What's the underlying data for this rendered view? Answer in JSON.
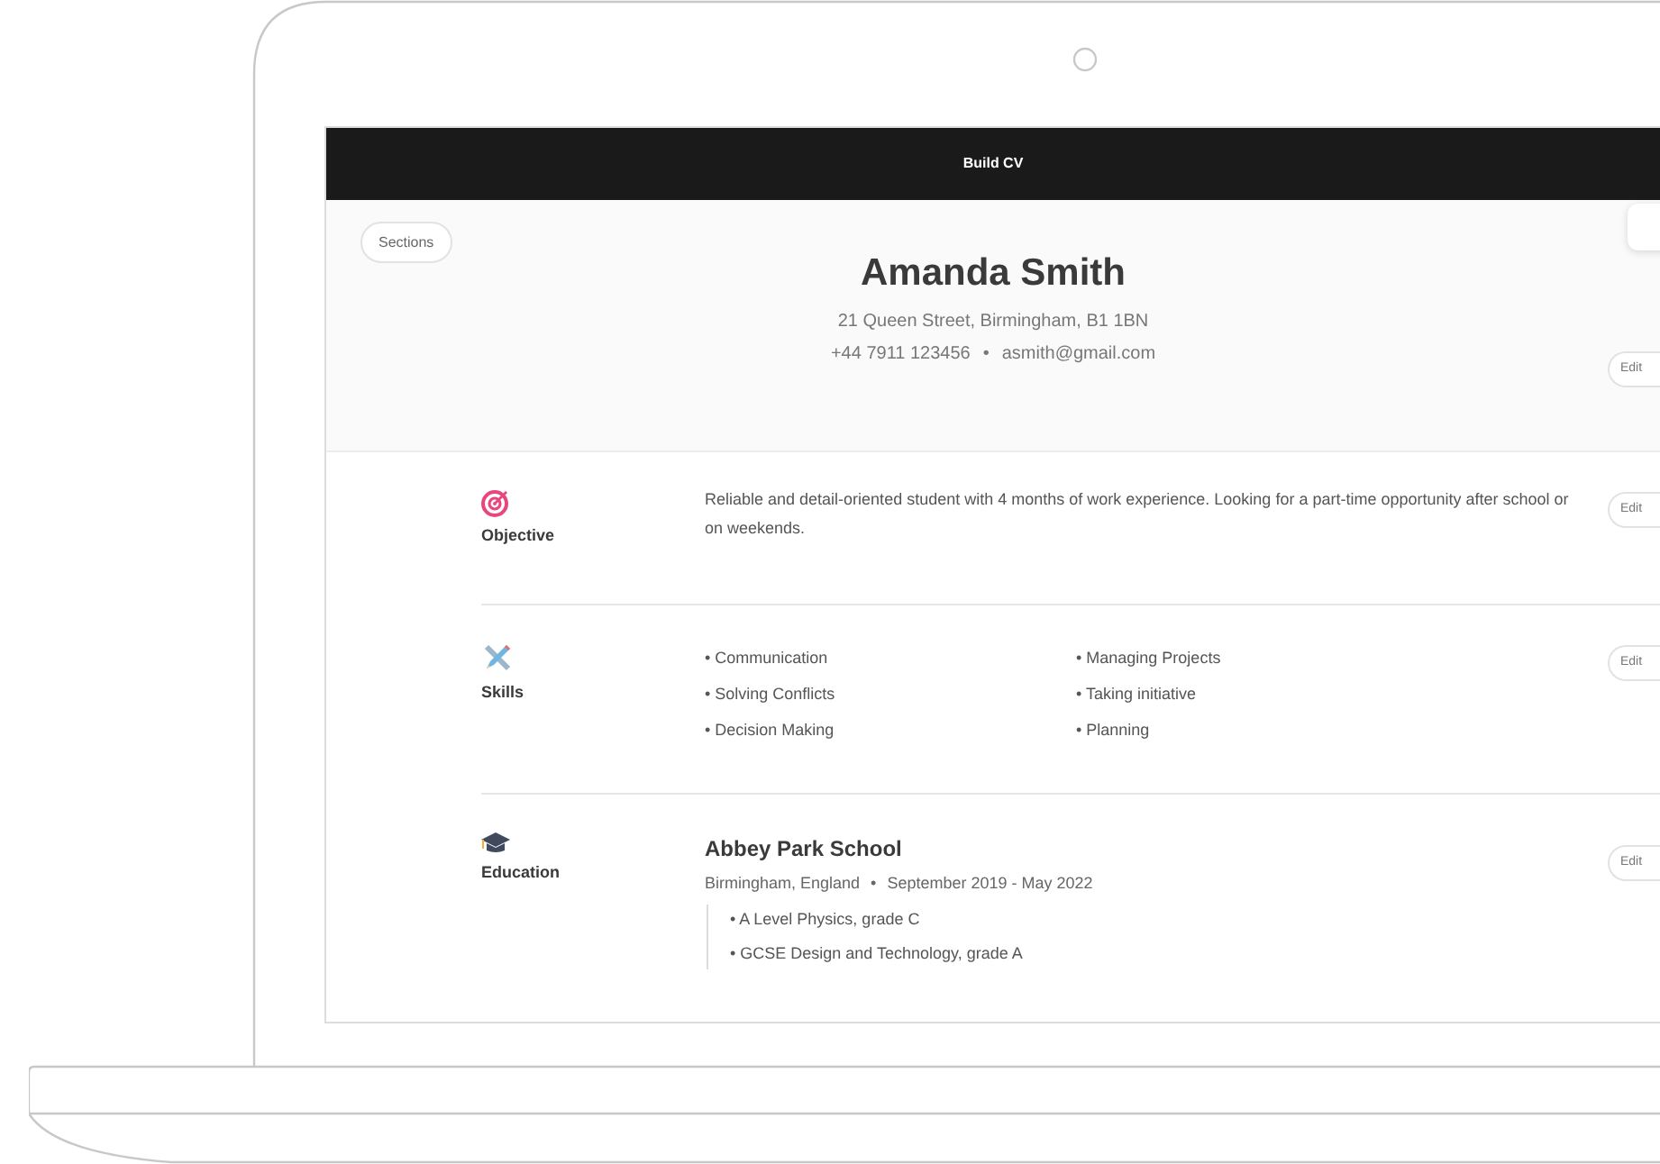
{
  "window": {
    "title": "Build CV"
  },
  "sections_button": "Sections",
  "header": {
    "name": "Amanda Smith",
    "address": "21 Queen Street, Birmingham, B1 1BN",
    "phone": "+44 7911 123456",
    "separator": "•",
    "email": "asmith@gmail.com",
    "edit": "Edit"
  },
  "sections": [
    {
      "kind": "objective",
      "label": "Objective",
      "edit": "Edit",
      "text": "Reliable and detail-oriented student with 4 months of work experience. Looking for a part-time opportunity after school or on weekends."
    },
    {
      "kind": "skills",
      "label": "Skills",
      "edit": "Edit",
      "columns": [
        [
          "• Communication",
          "• Solving Conflicts",
          "• Decision Making"
        ],
        [
          "• Managing Projects",
          "• Taking initiative",
          "• Planning"
        ]
      ]
    },
    {
      "kind": "education",
      "label": "Education",
      "edit": "Edit",
      "school": "Abbey Park School",
      "location": "Birmingham, England",
      "separator": "•",
      "dates": "September 2019 - May 2022",
      "items": [
        "• A Level Physics, grade C",
        "• GCSE Design and Technology, grade A"
      ]
    }
  ]
}
